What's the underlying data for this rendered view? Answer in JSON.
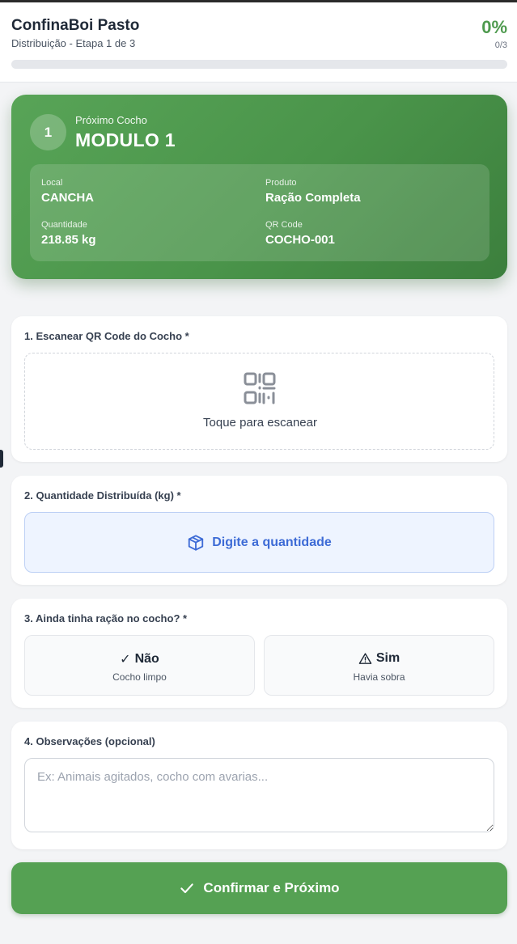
{
  "header": {
    "title": "ConfinaBoi Pasto",
    "subtitle": "Distribuição - Etapa 1 de 3",
    "progress_percent": "0%",
    "progress_count": "0/3",
    "progress_fraction": 0
  },
  "next_trough": {
    "step_number": "1",
    "label": "Próximo Cocho",
    "name": "MODULO 1",
    "local_label": "Local",
    "local_value": "CANCHA",
    "product_label": "Produto",
    "product_value": "Ração Completa",
    "quantity_label": "Quantidade",
    "quantity_value": "218.85 kg",
    "qr_label": "QR Code",
    "qr_value": "COCHO-001"
  },
  "scan_section": {
    "label": "1. Escanear QR Code do Cocho *",
    "prompt": "Toque para escanear",
    "icon": "qr-code-icon"
  },
  "quantity_section": {
    "label": "2. Quantidade Distribuída (kg) *",
    "button_label": "Digite a quantidade",
    "icon": "package-icon",
    "accent_color": "#3d6bd6"
  },
  "leftover_section": {
    "label": "3. Ainda tinha ração no cocho? *",
    "options": [
      {
        "glyph": "✓",
        "title": "Não",
        "subtitle": "Cocho limpo"
      },
      {
        "title": "Sim",
        "subtitle": "Havia sobra",
        "icon": "warning-icon"
      }
    ]
  },
  "notes_section": {
    "label": "4. Observações (opcional)",
    "placeholder": "Ex: Animais agitados, cocho com avarias...",
    "value": ""
  },
  "confirm_button": {
    "label": "Confirmar e Próximo",
    "icon": "check-icon",
    "color": "#55a153"
  },
  "theme": {
    "brand_green": "#4e9a4e",
    "background": "#f3f4f6"
  }
}
